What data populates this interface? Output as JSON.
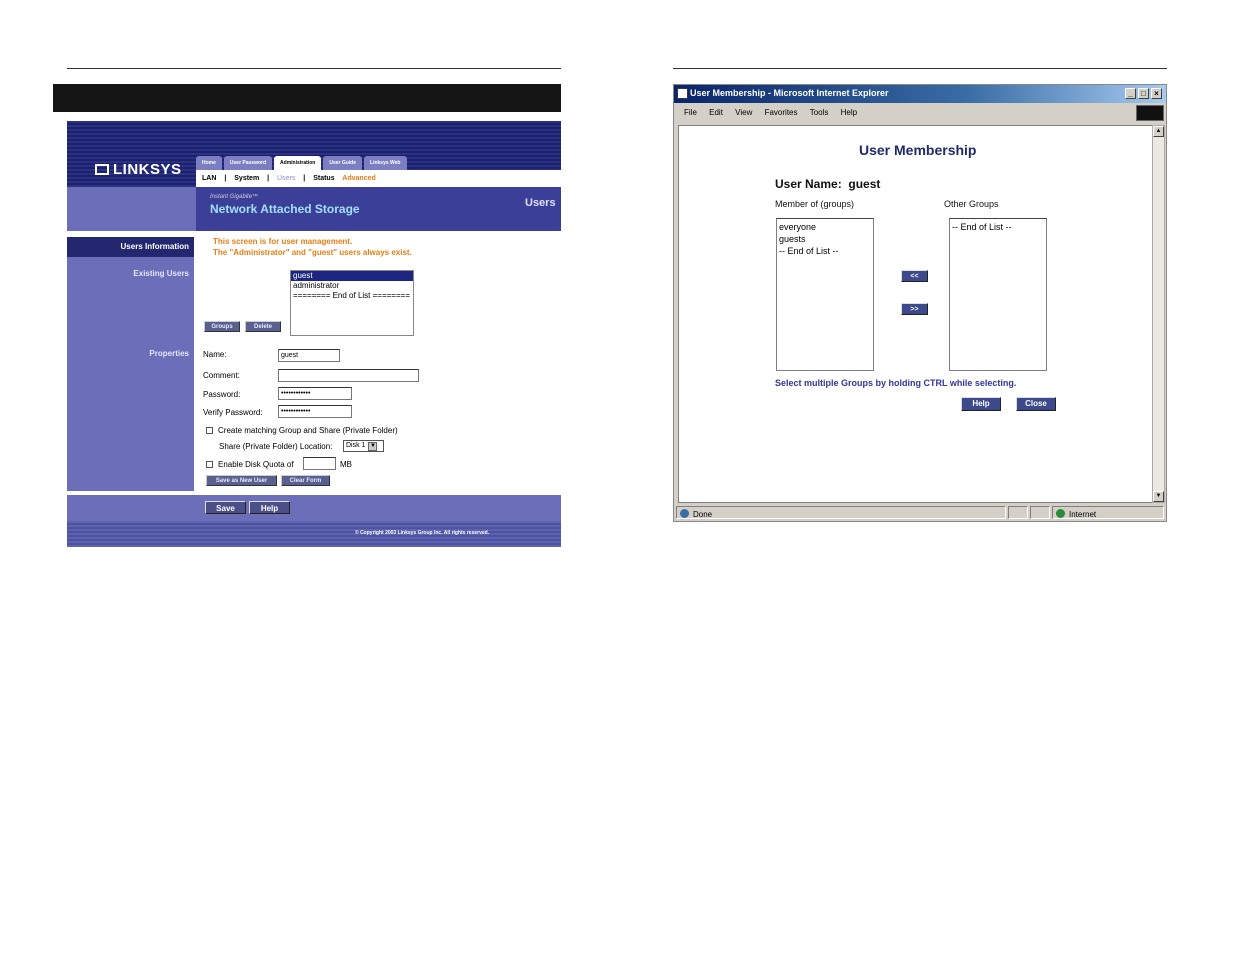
{
  "linksys": {
    "logo": "LINKSYS",
    "tabs": [
      "Home",
      "User Password",
      "Administration",
      "User Guide",
      "Linksys Web"
    ],
    "active_tab": "Administration",
    "subnav": {
      "lan": "LAN",
      "system": "System",
      "users": "Users",
      "status": "Status",
      "advanced": "Advanced",
      "separator": "|"
    },
    "product_small": "Instant Gigabite™",
    "product": "Network Attached Storage",
    "section_label": "Users",
    "sidebar": {
      "users_info": "Users Information",
      "existing_users": "Existing Users",
      "properties": "Properties"
    },
    "note_line1": "This screen is for user management.",
    "note_line2": "The \"Administrator\" and \"guest\" users always exist.",
    "user_list": [
      "guest",
      "administrator",
      "======== End of List ========"
    ],
    "buttons": {
      "groups": "Groups",
      "delete": "Delete",
      "save_new_user": "Save as New User",
      "clear_form": "Clear Form",
      "save": "Save",
      "help": "Help"
    },
    "form": {
      "name_label": "Name:",
      "name_value": "guest",
      "comment_label": "Comment:",
      "comment_value": "",
      "password_label": "Password:",
      "password_value": "••••••••••••",
      "verify_label": "Verify Password:",
      "verify_value": "••••••••••••",
      "create_group_label": "Create matching Group and Share (Private Folder)",
      "share_location_label": "Share (Private Folder) Location:",
      "share_location_value": "Disk 1",
      "disk_quota_label": "Enable Disk Quota of",
      "disk_quota_value": "",
      "disk_quota_unit": "MB"
    },
    "copyright": "© Copyright 2003 Linksys Group Inc. All rights reserved."
  },
  "ie": {
    "title": "User Membership - Microsoft Internet Explorer",
    "controls": [
      "_",
      "□",
      "×"
    ],
    "menu": [
      "File",
      "Edit",
      "View",
      "Favorites",
      "Tools",
      "Help"
    ],
    "status_left": "Done",
    "status_zone": "Internet",
    "page": {
      "title": "User Membership",
      "user_name_label": "User Name:",
      "user_name_value": "guest",
      "member_of_label": "Member of (groups)",
      "other_groups_label": "Other Groups",
      "member_of": [
        "everyone",
        "guests",
        "-- End of List --"
      ],
      "other_groups": [
        "-- End of List --"
      ],
      "move_left": "<<",
      "move_right": ">>",
      "hint": "Select multiple Groups by holding CTRL while selecting.",
      "help_button": "Help",
      "close_button": "Close"
    }
  }
}
